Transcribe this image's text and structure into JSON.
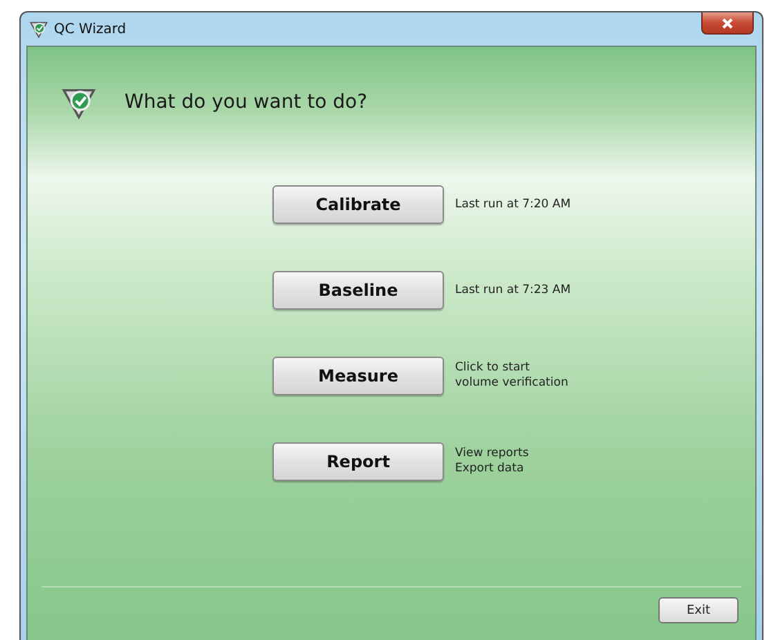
{
  "window": {
    "title": "QC Wizard"
  },
  "heading": "What do you want to do?",
  "actions": [
    {
      "label": "Calibrate",
      "description": [
        "Last run at 7:20 AM"
      ]
    },
    {
      "label": "Baseline",
      "description": [
        "Last run at 7:23 AM"
      ]
    },
    {
      "label": "Measure",
      "description": [
        "Click to start",
        "volume verification"
      ]
    },
    {
      "label": "Report",
      "description": [
        "View reports",
        "Export data"
      ]
    }
  ],
  "footer_button": "Exit"
}
